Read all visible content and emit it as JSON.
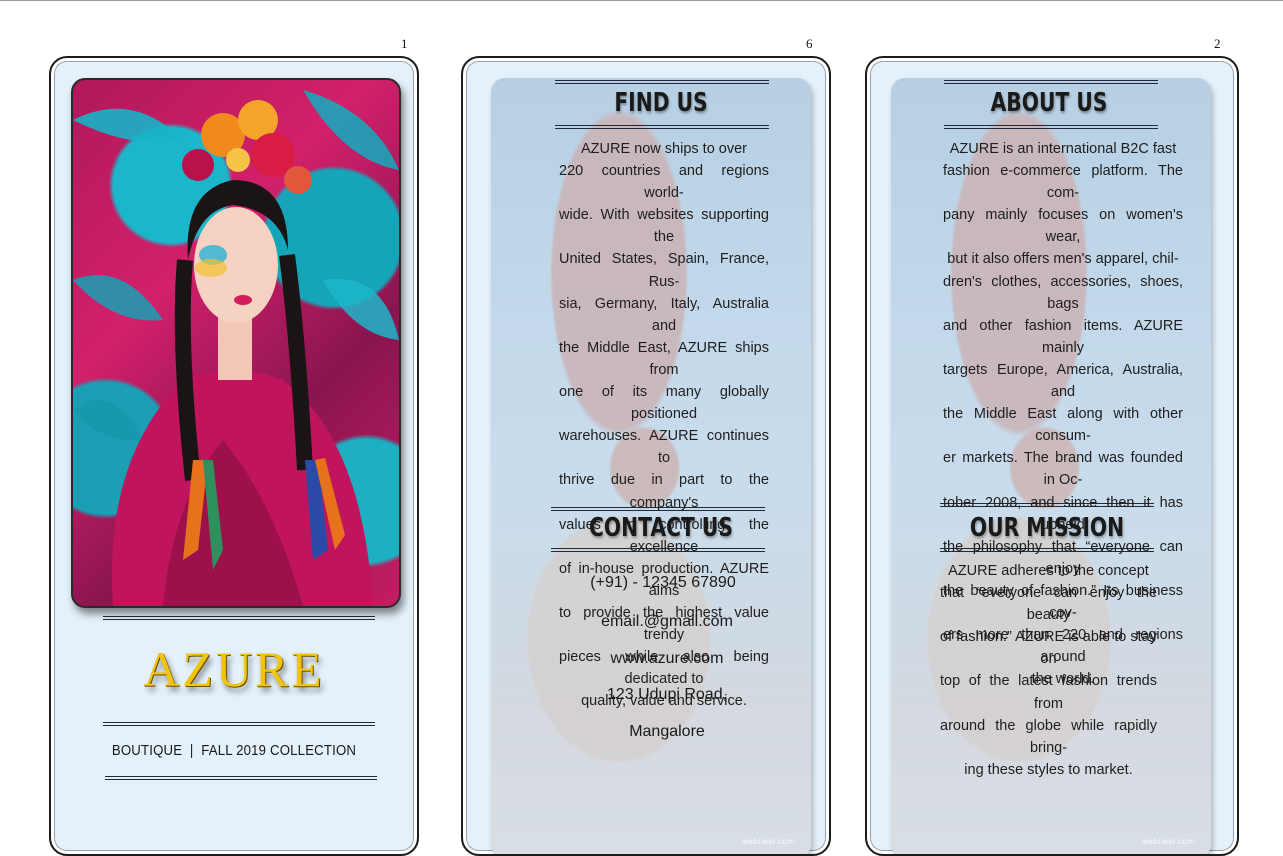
{
  "page_numbers": {
    "cover": "1",
    "find_us": "6",
    "about_us": "2"
  },
  "cover": {
    "image_icon": "woman-with-flower-crown-photo",
    "brand": "AZURE",
    "tagline": "BOUTIQUE  |  FALL 2019 COLLECTION"
  },
  "find_us": {
    "title": "FIND US",
    "lines": [
      "AZURE now ships to over",
      "220 countries and regions world-",
      "wide. With websites supporting the",
      "United States, Spain, France, Rus-",
      "sia, Germany, Italy, Australia and",
      "the Middle East, AZURE ships from",
      "one of its many globally positioned",
      "warehouses. AZURE continues to",
      "thrive due in part to the company's",
      "values in controlling the excellence",
      "of in-house production. AZURE aims",
      "to provide the highest value trendy",
      "pieces while also being dedicated to",
      "quality, value and service."
    ]
  },
  "contact_us": {
    "title": "CONTACT US",
    "phone": "(+91) - 12345 67890",
    "email": "email.@gmail.com",
    "website": "www.azure.com",
    "address_line1": "123 Udupi Road,",
    "address_line2": "Mangalore"
  },
  "about_us": {
    "title": "ABOUT US",
    "lines": [
      "AZURE is an international B2C fast",
      "fashion e-commerce platform. The com-",
      "pany mainly focuses on women's wear,",
      "but it also offers men's apparel, chil-",
      "dren's clothes, accessories, shoes, bags",
      "and other fashion items. AZURE mainly",
      "targets Europe, America, Australia, and",
      "the Middle East along with other consum-",
      "er markets. The brand was founded in Oc-",
      "tober 2008, and since then it has upheld",
      "the philosophy that “everyone can enjoy",
      "the beauty of fashion.” Its business cov-",
      "ers more than 220 and regions around",
      "the world."
    ]
  },
  "our_mission": {
    "title": "OUR MISSION",
    "lines": [
      "AZURE adheres to the concept",
      "that “everyone can enjoy the beauty",
      "of fashion.” AZURE is able to stay on",
      "top of the latest fashion trends from",
      "around the globe while rapidly bring-",
      "ing these styles to market."
    ]
  },
  "watermark": "webneel.com",
  "colors": {
    "brand_gold": "#f1c40f",
    "panel_bg": "#e4f0fa",
    "rule": "#1e2a38"
  }
}
